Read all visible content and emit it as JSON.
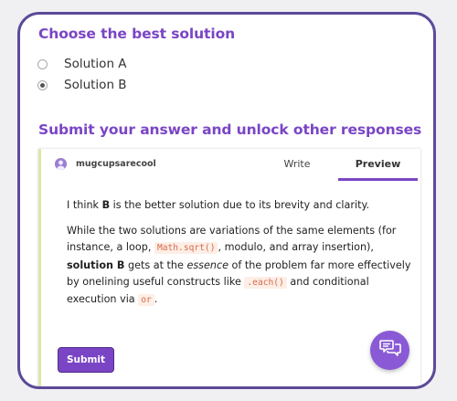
{
  "question": {
    "heading": "Choose the best solution",
    "options": [
      {
        "label": "Solution A",
        "checked": false
      },
      {
        "label": "Solution B",
        "checked": true
      }
    ]
  },
  "answer": {
    "heading": "Submit your answer and unlock other responses",
    "editor": {
      "username": "mugcupsarecool",
      "tabs": [
        {
          "label": "Write",
          "active": false
        },
        {
          "label": "Preview",
          "active": true
        }
      ],
      "paragraph1": {
        "t1": "I think ",
        "b1": "B",
        "t2": " is the better solution due to its brevity and clarity."
      },
      "paragraph2": {
        "t1": "While the two solutions are variations of the same elements (for instance, a loop, ",
        "code1": "Math.sqrt()",
        "t2": ", modulo, and array insertion), ",
        "b1": "solution B",
        "t3": " gets at the ",
        "em1": "essence",
        "t4": " of the problem far more effectively by onelining useful constructs like ",
        "code2": ".each()",
        "t5": " and conditional execution via ",
        "code3": "or",
        "t6": "."
      },
      "submit_label": "Submit"
    }
  },
  "chat_button": {
    "icon": "chat-bubbles-icon"
  },
  "colors": {
    "accent": "#7a45c5",
    "border": "#5c4a99",
    "code_text": "#d66b4a",
    "code_bg": "#fdeee6"
  }
}
